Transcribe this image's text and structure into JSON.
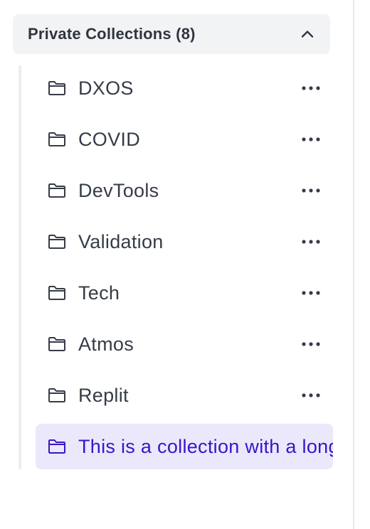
{
  "section": {
    "title": "Private Collections (8)",
    "collapse_icon": "chevron-up-icon"
  },
  "collections": [
    {
      "label": "DXOS",
      "icon": "folder-icon",
      "active": false
    },
    {
      "label": "COVID",
      "icon": "folder-icon",
      "active": false
    },
    {
      "label": "DevTools",
      "icon": "folder-icon",
      "active": false
    },
    {
      "label": "Validation",
      "icon": "folder-icon",
      "active": false
    },
    {
      "label": "Tech",
      "icon": "folder-icon",
      "active": false
    },
    {
      "label": "Atmos",
      "icon": "folder-icon",
      "active": false
    },
    {
      "label": "Replit",
      "icon": "folder-icon",
      "active": false
    },
    {
      "label": "This is a collection with a long name",
      "icon": "folder-icon",
      "active": true
    }
  ],
  "colors": {
    "header_bg": "#f2f3f5",
    "text": "#363c47",
    "active_bg": "#ebe8fc",
    "active_text": "#3a14c8",
    "icon": "#363c47"
  }
}
